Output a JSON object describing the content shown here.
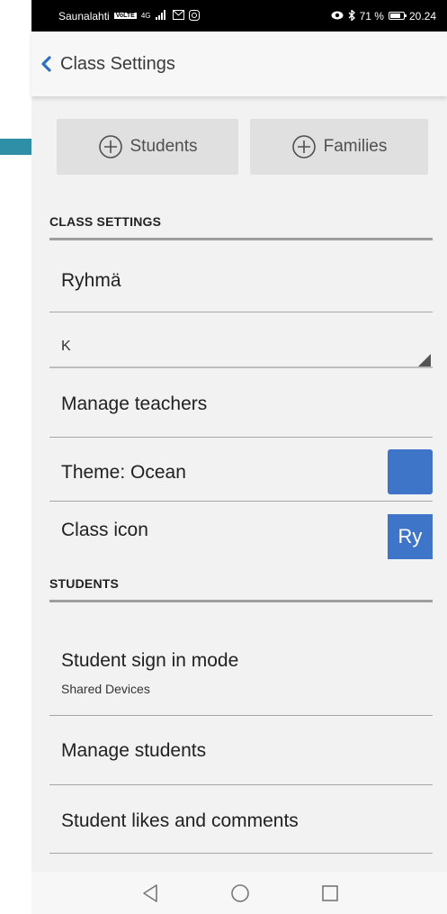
{
  "status_bar": {
    "carrier": "Saunalahti",
    "network_badge": "VoLTE",
    "network": "4G",
    "eye_icon": "eye-icon",
    "bluetooth_icon": "bluetooth-icon",
    "battery": "71 %",
    "time": "20.24"
  },
  "header": {
    "title": "Class Settings",
    "back_icon": "chevron-left-icon"
  },
  "actions": {
    "students_label": "Students",
    "families_label": "Families"
  },
  "class_settings": {
    "section_title": "CLASS SETTINGS",
    "class_name": "Ryhmä",
    "grade_value": "K",
    "manage_teachers": "Manage teachers",
    "theme_label": "Theme: Ocean",
    "theme_color": "#3f75c9",
    "class_icon_label": "Class icon",
    "class_icon_text": "Ry"
  },
  "students": {
    "section_title": "STUDENTS",
    "sign_in_label": "Student sign in mode",
    "sign_in_value": "Shared Devices",
    "manage_students": "Manage students",
    "likes_comments": "Student likes and comments"
  },
  "colors": {
    "accent": "#3f75c9",
    "arrow": "#2f8fa7",
    "back_chevron": "#2d6fc0"
  }
}
